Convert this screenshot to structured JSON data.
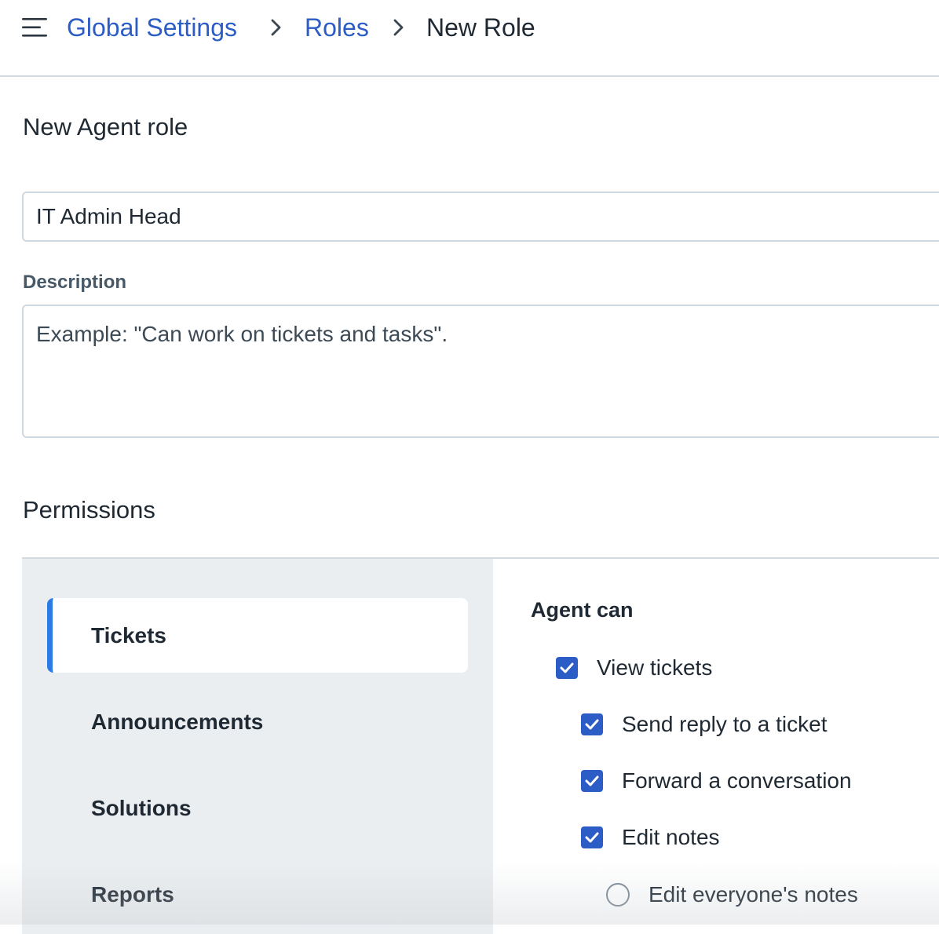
{
  "header": {
    "menu_icon": "hamburger-menu-icon",
    "breadcrumb": {
      "items": [
        "Global Settings",
        "Roles"
      ],
      "current": "New Role",
      "separator_icon": "chevron-right-icon"
    },
    "link_color": "#2c5cc5"
  },
  "form": {
    "title": "New Agent role",
    "role_name_value": "IT Admin Head",
    "description_label": "Description",
    "description_placeholder": "Example: \"Can work on tickets and tasks\"."
  },
  "permissions": {
    "title": "Permissions",
    "categories": [
      {
        "label": "Tickets",
        "active": true
      },
      {
        "label": "Announcements",
        "active": false
      },
      {
        "label": "Solutions",
        "active": false
      },
      {
        "label": "Reports",
        "active": false
      }
    ],
    "accent_color": "#2c7be5",
    "agent_can_label": "Agent can",
    "options": [
      {
        "label": "View tickets",
        "type": "checkbox",
        "checked": true
      },
      {
        "label": "Send reply to a ticket",
        "type": "checkbox",
        "checked": true
      },
      {
        "label": "Forward a conversation",
        "type": "checkbox",
        "checked": true
      },
      {
        "label": "Edit notes",
        "type": "checkbox",
        "checked": true
      },
      {
        "label": "Edit everyone's notes",
        "type": "radio",
        "checked": false
      }
    ]
  }
}
